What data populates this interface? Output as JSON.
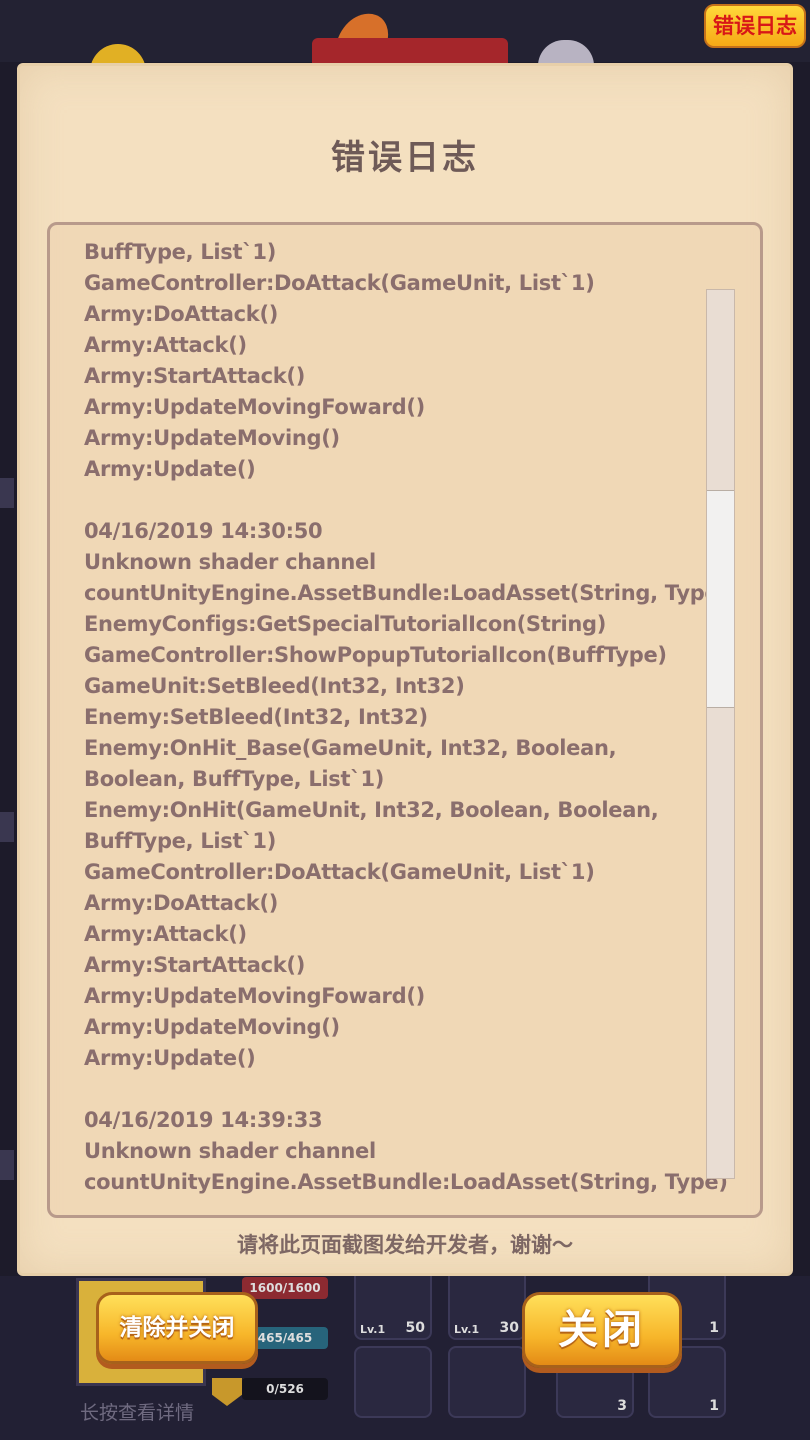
{
  "header": {
    "error_log_button": "错误日志"
  },
  "panel": {
    "title": "错误日志",
    "footer": "请将此页面截图发给开发者，谢谢～",
    "log_lines": [
      "BuffType, List`1)",
      "GameController:DoAttack(GameUnit, List`1)",
      "Army:DoAttack()",
      "Army:Attack()",
      "Army:StartAttack()",
      "Army:UpdateMovingFoward()",
      "Army:UpdateMoving()",
      "Army:Update()",
      "",
      "04/16/2019 14:30:50",
      "Unknown shader channel",
      "countUnityEngine.AssetBundle:LoadAsset(String, Type)",
      "EnemyConfigs:GetSpecialTutorialIcon(String)",
      "GameController:ShowPopupTutorialIcon(BuffType)",
      "GameUnit:SetBleed(Int32, Int32)",
      "Enemy:SetBleed(Int32, Int32)",
      "Enemy:OnHit_Base(GameUnit, Int32, Boolean,",
      "Boolean, BuffType, List`1)",
      "Enemy:OnHit(GameUnit, Int32, Boolean, Boolean,",
      "BuffType, List`1)",
      "GameController:DoAttack(GameUnit, List`1)",
      "Army:DoAttack()",
      "Army:Attack()",
      "Army:StartAttack()",
      "Army:UpdateMovingFoward()",
      "Army:UpdateMoving()",
      "Army:Update()",
      "",
      "04/16/2019 14:39:33",
      "Unknown shader channel",
      "countUnityEngine.AssetBundle:LoadAsset(String, Type)"
    ]
  },
  "buttons": {
    "clear_and_close": "清除并关闭",
    "close": "关闭"
  },
  "background": {
    "hp": "1600/1600",
    "mp": "465/465",
    "xp": "0/526",
    "hint": "长按查看详情",
    "slots": [
      {
        "level": "Lv.1",
        "count": "50"
      },
      {
        "level": "Lv.1",
        "count": "30"
      },
      {
        "level": "",
        "count": "1"
      },
      {
        "level": "",
        "count": "3"
      },
      {
        "level": "",
        "count": "1"
      }
    ]
  },
  "colors": {
    "panel_bg": "#f4e0c0",
    "log_text": "#8a6e6d",
    "title_text": "#6e5a57",
    "button_yellow": "#f7b62a",
    "error_button_text": "#d81717"
  }
}
